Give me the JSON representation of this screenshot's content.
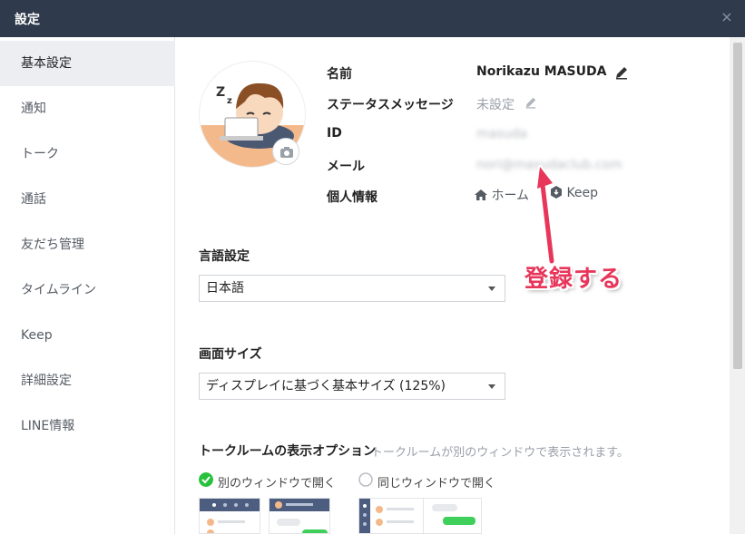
{
  "window": {
    "title": "設定",
    "close_glyph": "×"
  },
  "sidebar": {
    "items": [
      {
        "label": "基本設定",
        "active": true
      },
      {
        "label": "通知"
      },
      {
        "label": "トーク"
      },
      {
        "label": "通話"
      },
      {
        "label": "友だち管理"
      },
      {
        "label": "タイムライン"
      },
      {
        "label": "Keep"
      },
      {
        "label": "詳細設定"
      },
      {
        "label": "LINE情報"
      }
    ]
  },
  "profile": {
    "name_label": "名前",
    "name_value": "Norikazu MASUDA",
    "status_label": "ステータスメッセージ",
    "status_value": "未設定",
    "id_label": "ID",
    "id_value": "masuda",
    "mail_label": "メール",
    "mail_value": "nori@masudaclub.com",
    "info_label": "個人情報",
    "home_link": "ホーム",
    "keep_link": "Keep"
  },
  "language": {
    "title": "言語設定",
    "selected": "日本語"
  },
  "screen_size": {
    "title": "画面サイズ",
    "selected": "ディスプレイに基づく基本サイズ (125%)"
  },
  "talk_room": {
    "title": "トークルームの表示オプション",
    "description": "トークルームが別のウィンドウで表示されます。",
    "option_separate": "別のウィンドウで開く",
    "option_same": "同じウィンドウで開く",
    "selected": "separate"
  },
  "annotation": {
    "text": "登録する",
    "color": "#e8365b"
  },
  "colors": {
    "titlebar": "#2f3a4c",
    "accent_green": "#27c13c",
    "sidebar_active": "#eceef2"
  }
}
